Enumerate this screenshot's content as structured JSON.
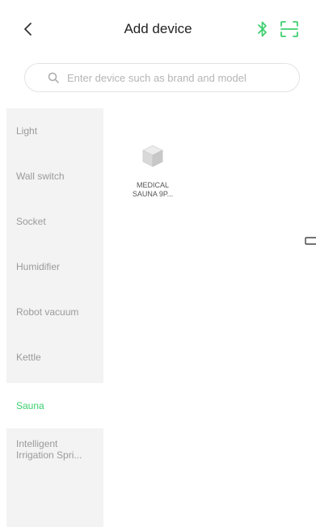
{
  "header": {
    "title": "Add device",
    "back_icon": "chevron-left-icon",
    "bluetooth_icon": "bluetooth-icon",
    "scan_icon": "scan-icon",
    "accent_color": "#3ccf6e"
  },
  "search": {
    "placeholder": "Enter device such as brand and model",
    "value": ""
  },
  "sidebar": {
    "items": [
      {
        "label": "Light"
      },
      {
        "label": "Wall switch"
      },
      {
        "label": "Socket"
      },
      {
        "label": "Humidifier"
      },
      {
        "label": "Robot vacuum"
      },
      {
        "label": "Kettle"
      },
      {
        "label": "Sauna"
      },
      {
        "label": "Intelligent\nIrrigation Spri..."
      }
    ],
    "selected": "Sauna"
  },
  "devices": [
    {
      "name": "MEDICAL\nSAUNA 9P...",
      "icon": "cube-icon"
    }
  ]
}
